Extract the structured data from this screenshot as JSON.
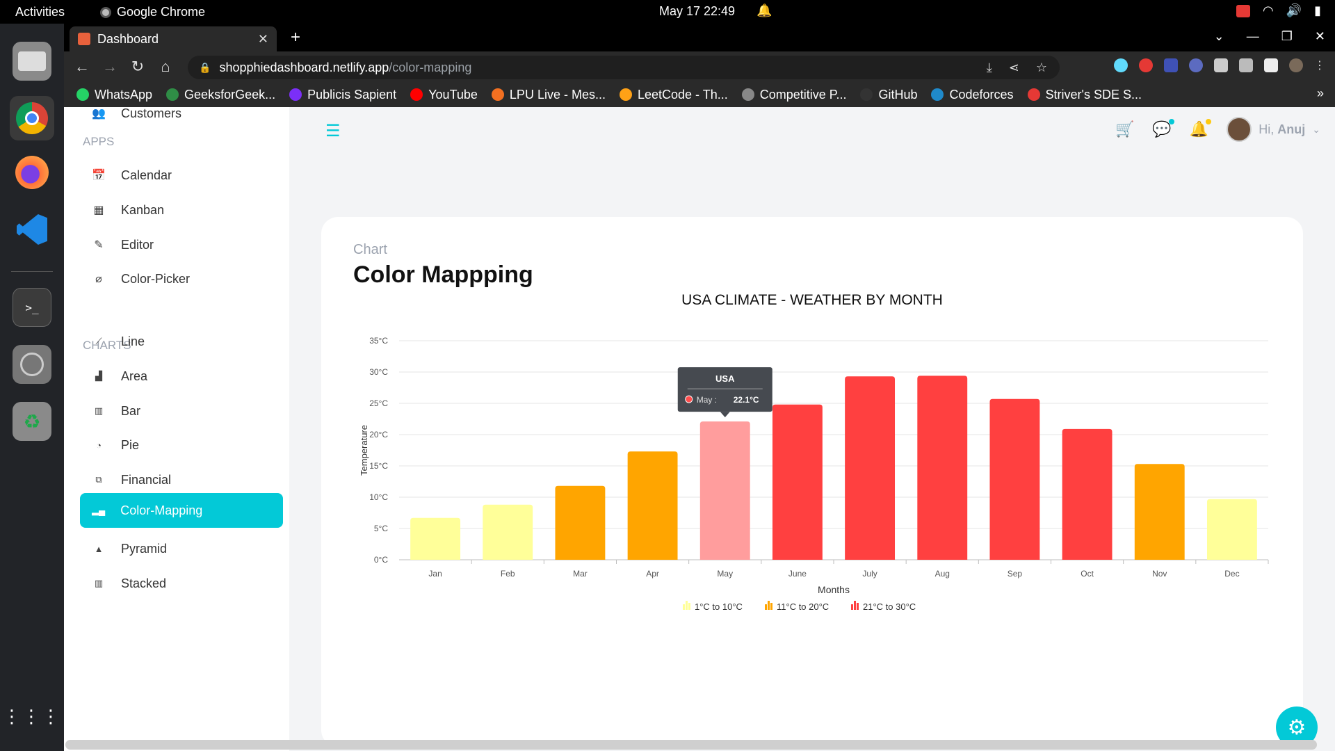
{
  "system": {
    "activities": "Activities",
    "app_name": "Google Chrome",
    "clock": "May 17  22:49"
  },
  "browser": {
    "tab_title": "Dashboard",
    "url_host": "shopphiedashboard.netlify.app",
    "url_path": "/color-mapping",
    "bookmarks": [
      {
        "label": "WhatsApp",
        "color": "#25d366"
      },
      {
        "label": "GeeksforGeek...",
        "color": "#2f8d46"
      },
      {
        "label": "Publicis Sapient",
        "color": "#7b2ff7"
      },
      {
        "label": "YouTube",
        "color": "#ff0000"
      },
      {
        "label": "LPU Live - Mes...",
        "color": "#f37021"
      },
      {
        "label": "LeetCode - Th...",
        "color": "#ffa116"
      },
      {
        "label": "Competitive P...",
        "color": "#888888"
      },
      {
        "label": "GitHub",
        "color": "#333333"
      },
      {
        "label": "Codeforces",
        "color": "#1f8acb"
      },
      {
        "label": "Striver's SDE S...",
        "color": "#e53935"
      }
    ]
  },
  "sidebar": {
    "top_item": "Customers",
    "apps_section": "APPS",
    "apps": [
      "Calendar",
      "Kanban",
      "Editor",
      "Color-Picker"
    ],
    "charts_section": "CHARTS",
    "charts": [
      "Line",
      "Area",
      "Bar",
      "Pie",
      "Financial",
      "Color-Mapping",
      "Pyramid",
      "Stacked"
    ],
    "active": "Color-Mapping"
  },
  "navbar": {
    "greeting": "Hi,",
    "user": "Anuj"
  },
  "header": {
    "category": "Chart",
    "title": "Color Mappping"
  },
  "chart_data": {
    "type": "bar",
    "title": "USA CLIMATE - WEATHER BY MONTH",
    "xlabel": "Months",
    "ylabel": "Temperature",
    "categories": [
      "Jan",
      "Feb",
      "Mar",
      "Apr",
      "May",
      "June",
      "July",
      "Aug",
      "Sep",
      "Oct",
      "Nov",
      "Dec"
    ],
    "series": [
      {
        "name": "USA",
        "values": [
          6.7,
          8.8,
          11.8,
          17.3,
          22.1,
          24.8,
          29.3,
          29.4,
          25.7,
          20.9,
          15.3,
          9.7
        ]
      }
    ],
    "ylim": [
      0,
      35
    ],
    "yticks": [
      "0°C",
      "5°C",
      "10°C",
      "15°C",
      "20°C",
      "25°C",
      "30°C",
      "35°C"
    ],
    "grid": true,
    "color_ranges": [
      {
        "label": "1°C to 10°C",
        "color": "#FFFF99"
      },
      {
        "label": "11°C to 20°C",
        "color": "#FFA500"
      },
      {
        "label": "21°C to 30°C",
        "color": "#FF4040"
      }
    ],
    "highlighted_index": 4,
    "highlight_color": "#FF9D9D",
    "tooltip": {
      "header": "USA",
      "label": "May : ",
      "value": "22.1°C"
    }
  },
  "colors": {
    "accent": "#03c9d7"
  }
}
